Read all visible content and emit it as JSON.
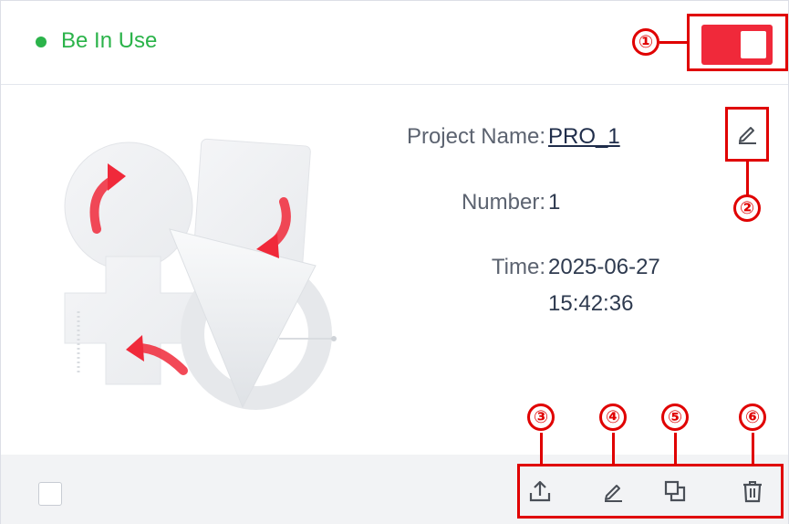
{
  "status": {
    "label": "Be In Use",
    "color": "#2bb34a"
  },
  "toggle": {
    "state": "on",
    "color": "#f0293a"
  },
  "details": {
    "project_name_label": "Project Name:",
    "project_name_value": "PRO_1",
    "number_label": "Number:",
    "number_value": "1",
    "time_label": "Time:",
    "time_date": "2025-06-27",
    "time_clock": "15:42:36"
  },
  "callouts": [
    "①",
    "②",
    "③",
    "④",
    "⑤",
    "⑥"
  ],
  "toolbar": {
    "icons": [
      "upload-icon",
      "edit-icon",
      "copy-icon",
      "delete-icon"
    ]
  },
  "colors": {
    "annotation_red": "#e00000",
    "accent_red": "#f0293a"
  }
}
